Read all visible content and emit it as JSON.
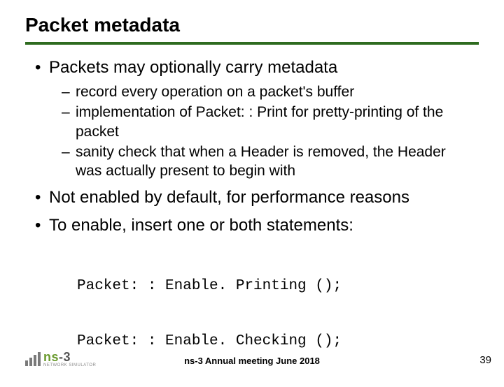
{
  "title": "Packet metadata",
  "bullets": {
    "b1": "Packets may optionally carry metadata",
    "b1_sub": {
      "s1": "record every operation on a packet's buffer",
      "s2": "implementation of Packet: : Print for pretty-printing of the packet",
      "s3": "sanity check that when a Header is removed, the Header was actually present to begin with"
    },
    "b2": "Not enabled by default, for performance reasons",
    "b3": "To enable, insert one or both statements:"
  },
  "code": {
    "line1": "Packet: : Enable. Printing ();",
    "line2": "Packet: : Enable. Checking ();"
  },
  "footer": {
    "text": "ns-3 Annual meeting June 2018",
    "page": "39"
  },
  "logo": {
    "brand_prefix": "ns",
    "brand_suffix": "-3",
    "subtitle": "NETWORK SIMULATOR"
  }
}
